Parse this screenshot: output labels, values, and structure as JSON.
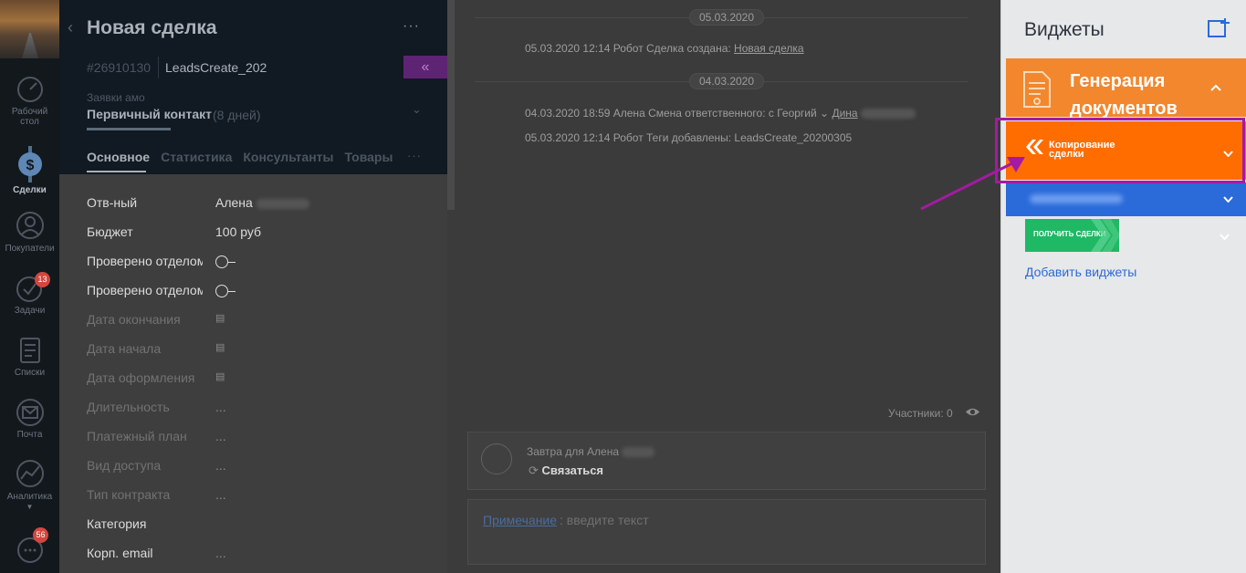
{
  "nav": {
    "items": [
      {
        "label_lines": [
          "Рабочий",
          "стол"
        ],
        "icon": "dashboard-gauge-icon"
      },
      {
        "label_lines": [
          "Сделки"
        ],
        "icon": "deals-dollar-icon",
        "active": true
      },
      {
        "label_lines": [
          "Покупатели"
        ],
        "icon": "customers-icon"
      },
      {
        "label_lines": [
          "Задачи"
        ],
        "icon": "tasks-check-icon",
        "badge": "13"
      },
      {
        "label_lines": [
          "Списки"
        ],
        "icon": "lists-icon"
      },
      {
        "label_lines": [
          "Почта"
        ],
        "icon": "mail-icon"
      },
      {
        "label_lines": [
          "Аналитика"
        ],
        "icon": "analytics-chart-icon"
      }
    ],
    "chat_badge": "56"
  },
  "card": {
    "title": "Новая сделка",
    "more": "···",
    "id": "#26910130",
    "name": "LeadsCreate_202",
    "collapse": "«",
    "pipeline": "Заявки амо",
    "stage": "Первичный контакт",
    "stage_days": "(8 дней)",
    "tabs": [
      "Основное",
      "Статистика",
      "Консультанты",
      "Товары"
    ],
    "tabs_more": "···",
    "fields": [
      {
        "label": "Отв-ный",
        "value": "Алена",
        "type": "user"
      },
      {
        "label": "Бюджет",
        "value": "100 руб",
        "type": "text"
      },
      {
        "label": "Проверено отделом",
        "value": "",
        "type": "toggle"
      },
      {
        "label": "Проверено отделом",
        "value": "",
        "type": "toggle"
      },
      {
        "label": "Дата окончания",
        "value": "▤",
        "type": "date"
      },
      {
        "label": "Дата начала",
        "value": "▤",
        "type": "date"
      },
      {
        "label": "Дата оформления",
        "value": "▤",
        "type": "date"
      },
      {
        "label": "Длительность",
        "value": "...",
        "type": "text"
      },
      {
        "label": "Платежный план",
        "value": "...",
        "type": "text"
      },
      {
        "label": "Вид доступа",
        "value": "...",
        "type": "text"
      },
      {
        "label": "Тип контракта",
        "value": "...",
        "type": "text"
      },
      {
        "label": "Категория",
        "value": "",
        "type": "text"
      },
      {
        "label": "Корп. email",
        "value": "...",
        "type": "text"
      }
    ]
  },
  "feed": {
    "dates": [
      "05.03.2020",
      "04.03.2020"
    ],
    "events": [
      {
        "text": "05.03.2020 12:14 Робот  Сделка создана: ",
        "link": "Новая сделка"
      },
      {
        "text": "04.03.2020 18:59 Алена               Смена ответственного: с Георгий ⌄  ",
        "link": "Дина"
      },
      {
        "text": "05.03.2020 12:14 Робот  Теги добавлены: LeadsCreate_20200305",
        "link": ""
      }
    ],
    "members": "Участники: 0",
    "task_who": "Завтра для Алена",
    "task_action": "Связаться",
    "note_label": "Примечание",
    "note_placeholder": ": введите текст"
  },
  "widgets": {
    "title": "Виджеты",
    "gen_lines": [
      "Генерация",
      "документов"
    ],
    "copy_lines": [
      "Копирование",
      "сделки"
    ],
    "green_label": "ПОЛУЧИТЬ СДЕЛКИ",
    "add_link": "Добавить виджеты"
  },
  "colors": {
    "orange_gen": "#f2872e",
    "orange_copy": "#ff6d00",
    "blue": "#2a6ad9",
    "green": "#1fb865",
    "highlight": "#a51aa3"
  }
}
